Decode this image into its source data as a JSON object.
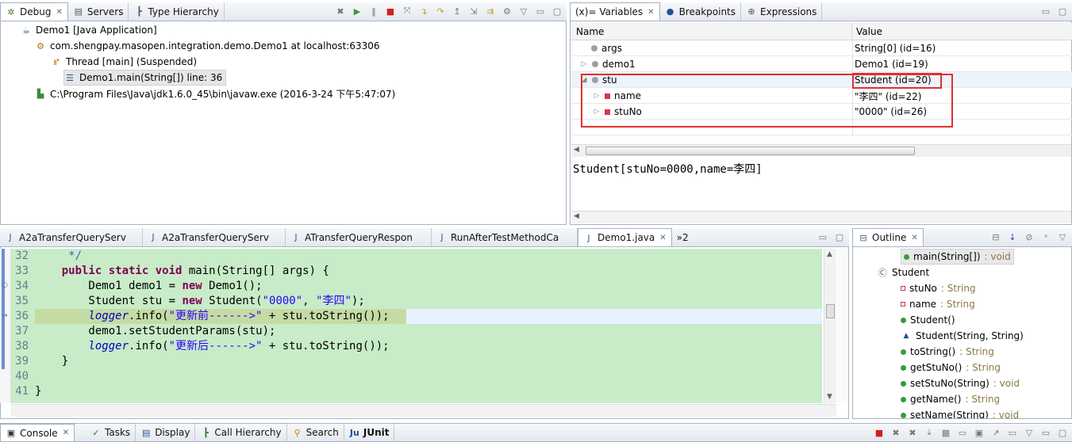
{
  "debug": {
    "tabs": [
      {
        "label": "Debug",
        "icon": "bug-icon"
      },
      {
        "label": "Servers",
        "icon": "servers-icon"
      },
      {
        "label": "Type Hierarchy",
        "icon": "hierarchy-icon"
      }
    ],
    "tree": [
      "Demo1 [Java Application]",
      "com.shengpay.masopen.integration.demo.Demo1 at localhost:63306",
      "Thread [main] (Suspended)",
      "Demo1.main(String[]) line: 36",
      "C:\\Program Files\\Java\\jdk1.6.0_45\\bin\\javaw.exe (2016-3-24 下午5:47:07)"
    ]
  },
  "variables": {
    "tabs": [
      {
        "label": "(x)= Variables"
      },
      {
        "label": "Breakpoints"
      },
      {
        "label": "Expressions"
      }
    ],
    "columns": [
      "Name",
      "Value"
    ],
    "rows": [
      {
        "name": "args",
        "value": "String[0]  (id=16)"
      },
      {
        "name": "demo1",
        "value": "Demo1  (id=19)"
      },
      {
        "name": "stu",
        "value": "Student  (id=20)"
      },
      {
        "name": "name",
        "value": "\"李四\" (id=22)"
      },
      {
        "name": "stuNo",
        "value": "\"0000\" (id=26)"
      }
    ],
    "detail": "Student[stuNo=0000,name=李四]",
    "highlight_color": "#e03030"
  },
  "editor": {
    "tabs": [
      "A2aTransferQueryServ",
      "A2aTransferQueryServ",
      "ATransferQueryRespon",
      "RunAfterTestMethodCa",
      "Demo1.java"
    ],
    "overflow": "»2",
    "lines": [
      {
        "n": "32",
        "parts": [
          [
            "cm",
            "     */"
          ]
        ]
      },
      {
        "n": "33",
        "parts": [
          [
            "",
            "    "
          ],
          [
            "kw",
            "public static void"
          ],
          [
            "",
            " main(String[] args) {"
          ]
        ]
      },
      {
        "n": "34",
        "parts": [
          [
            "",
            "        Demo1 demo1 = "
          ],
          [
            "kw",
            "new"
          ],
          [
            "",
            " Demo1();"
          ]
        ]
      },
      {
        "n": "35",
        "parts": [
          [
            "",
            "        Student stu = "
          ],
          [
            "kw",
            "new"
          ],
          [
            "",
            " Student("
          ],
          [
            "str",
            "\"0000\""
          ],
          [
            "",
            ", "
          ],
          [
            "str",
            "\"李四\""
          ],
          [
            "",
            ");"
          ]
        ]
      },
      {
        "n": "36",
        "parts": [
          [
            "",
            "        "
          ],
          [
            "it",
            "logger"
          ],
          [
            "",
            ".info("
          ],
          [
            "str",
            "\"更新前------>\""
          ],
          [
            "",
            " + stu.toString());"
          ]
        ]
      },
      {
        "n": "37",
        "parts": [
          [
            "",
            "        demo1.setStudentParams(stu);"
          ]
        ]
      },
      {
        "n": "38",
        "parts": [
          [
            "",
            "        "
          ],
          [
            "it",
            "logger"
          ],
          [
            "",
            ".info("
          ],
          [
            "str",
            "\"更新后------>\""
          ],
          [
            "",
            " + stu.toString());"
          ]
        ]
      },
      {
        "n": "39",
        "parts": [
          [
            "",
            "    }"
          ]
        ]
      },
      {
        "n": "40",
        "parts": [
          [
            "",
            ""
          ]
        ]
      },
      {
        "n": "41",
        "parts": [
          [
            "",
            "}"
          ]
        ]
      }
    ]
  },
  "outline": {
    "title": "Outline",
    "items": [
      {
        "label": "main(String[]) : void",
        "kind": "method-static"
      },
      {
        "label": "Student",
        "kind": "class"
      },
      {
        "label": "stuNo : String",
        "kind": "field"
      },
      {
        "label": "name : String",
        "kind": "field"
      },
      {
        "label": "Student()",
        "kind": "ctor"
      },
      {
        "label": "Student(String, String)",
        "kind": "ctor"
      },
      {
        "label": "toString() : String",
        "kind": "method"
      },
      {
        "label": "getStuNo() : String",
        "kind": "method"
      },
      {
        "label": "setStuNo(String) : void",
        "kind": "method"
      },
      {
        "label": "getName() : String",
        "kind": "method"
      },
      {
        "label": "setName(String) : void",
        "kind": "method"
      }
    ]
  },
  "bottom": {
    "tabs": [
      "Console",
      "Tasks",
      "Display",
      "Call Hierarchy",
      "Search",
      "JUnit"
    ]
  }
}
